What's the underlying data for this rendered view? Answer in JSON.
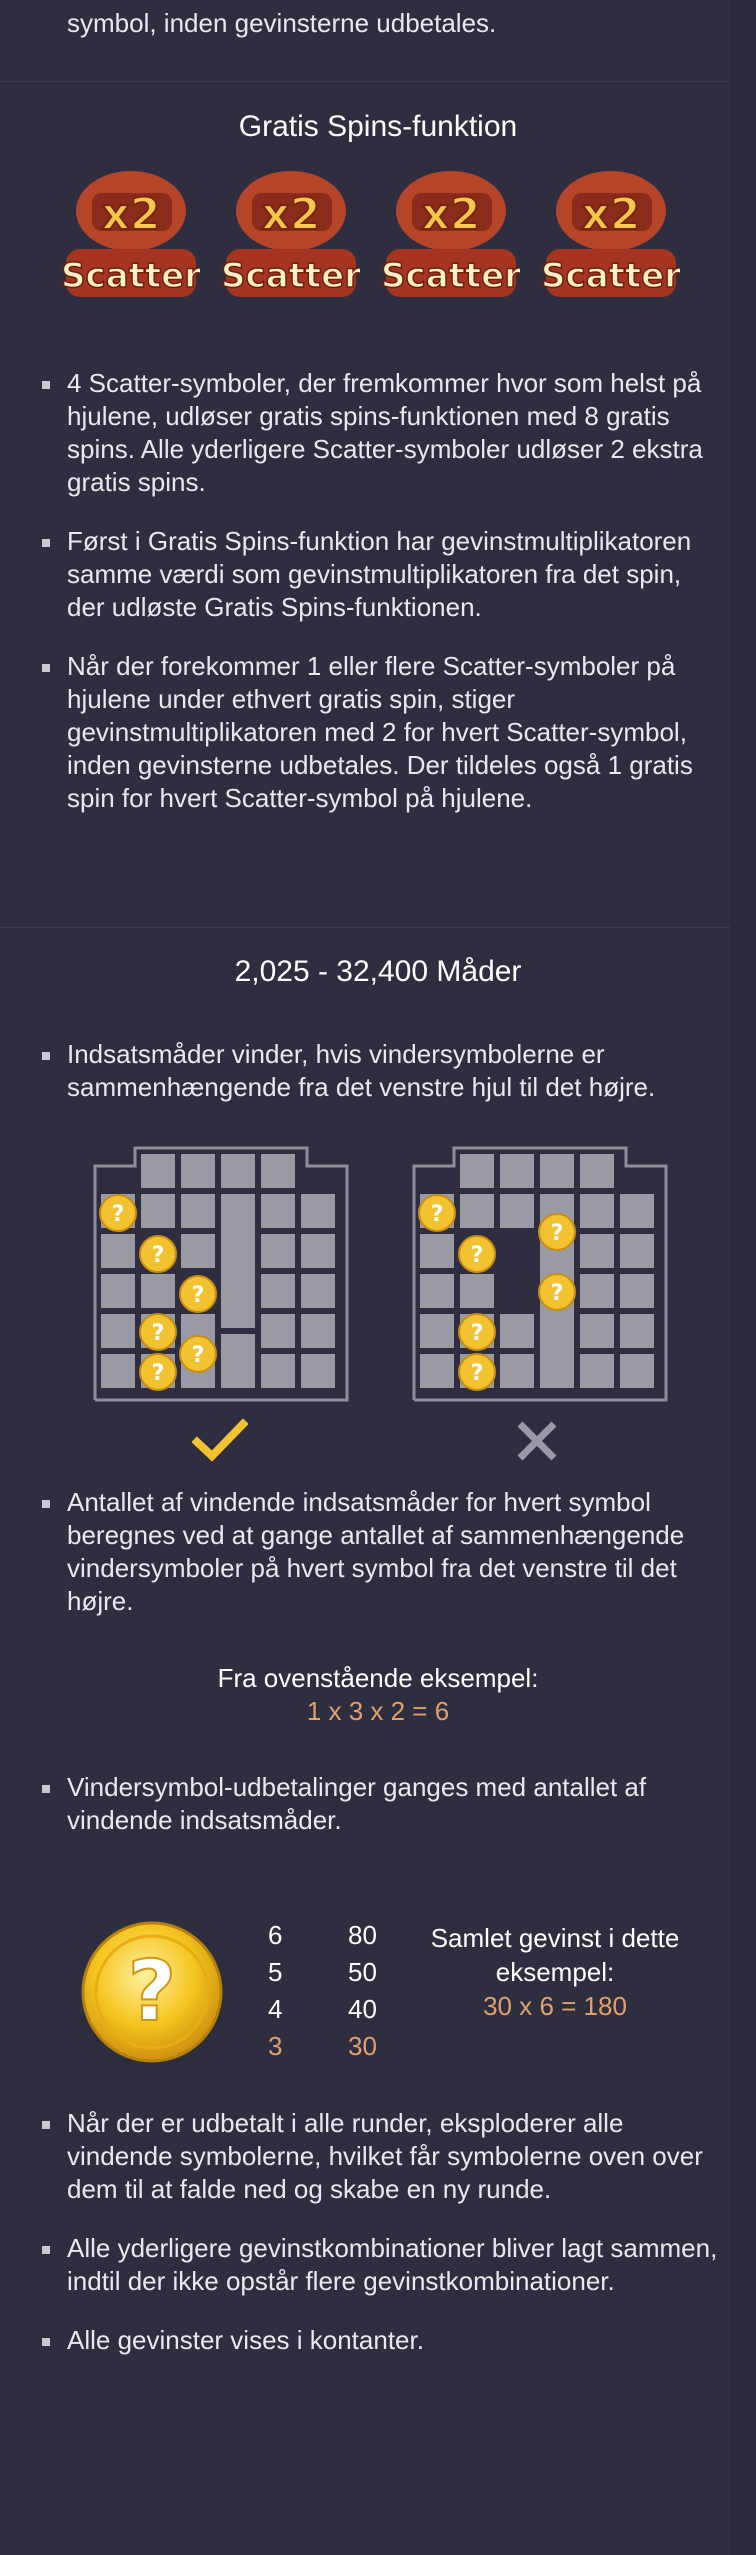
{
  "intro": {
    "text": "symbol, inden gevinsterne udbetales."
  },
  "free_spins": {
    "title": "Gratis Spins-funktion",
    "scatter_symbols": [
      {
        "label": "x2",
        "text": "Scatter"
      },
      {
        "label": "x2",
        "text": "Scatter"
      },
      {
        "label": "x2",
        "text": "Scatter"
      },
      {
        "label": "x2",
        "text": "Scatter"
      }
    ],
    "bullets": [
      "4 Scatter-symboler, der fremkommer hvor som helst på hjulene, udløser gratis spins-funktionen med 8 gratis spins. Alle yderligere Scatter-symboler udløser 2 ekstra gratis spins.",
      "Først i Gratis Spins-funktion har gevinstmultiplikatoren samme værdi som gevinstmultiplikatoren fra det spin, der udløste Gratis Spins-funktionen.",
      "Når der forekommer 1 eller flere Scatter-symboler på hjulene under ethvert gratis spin, stiger gevinstmultiplikatoren med 2 for hvert Scatter-symbol, inden gevinsterne udbetales. Der tildeles også 1 gratis spin for hvert Scatter-symbol på hjulene."
    ]
  },
  "ways": {
    "title": "2,025 - 32,400 Måder",
    "bullet1": "Indsatsmåder vinder, hvis vindersymbolerne er sammenhængende fra det venstre hjul til det højre.",
    "valid_icon": "check-icon",
    "invalid_icon": "cross-icon",
    "bullet2": "Antallet af vindende indsatsmåder for hvert symbol beregnes ved at gange antallet af sammenhængende vindersymboler på hvert symbol fra det venstre til det højre.",
    "example_head": "Fra ovenstående eksempel:",
    "example_value": "1 x 3 x 2 = 6",
    "bullet3": "Vindersymbol-udbetalinger ganges med antallet af vindende indsatsmåder.",
    "symbol_icon": "question-coin-icon",
    "paytable": [
      {
        "count": "6",
        "pay": "80"
      },
      {
        "count": "5",
        "pay": "50"
      },
      {
        "count": "4",
        "pay": "40"
      },
      {
        "count": "3",
        "pay": "30"
      }
    ],
    "total_head": "Samlet gevinst i dette eksempel:",
    "total_value": "30 x 6 = 180"
  },
  "footer_bullets": [
    "Når der er udbetalt i alle runder, eksploderer alle vindende symbolerne, hvilket får symbolerne oven over dem til at falde ned og skabe en ny runde.",
    "Alle yderligere gevinstkombinationer bliver lagt sammen, indtil der ikke opstår flere gevinstkombinationer.",
    "Alle gevinster vises i kontanter."
  ],
  "colors": {
    "background": "#2f2e40",
    "accent": "#e0a06a",
    "check": "#f2c230",
    "cross": "#9a9aa6",
    "grid": "#8f8f99"
  }
}
